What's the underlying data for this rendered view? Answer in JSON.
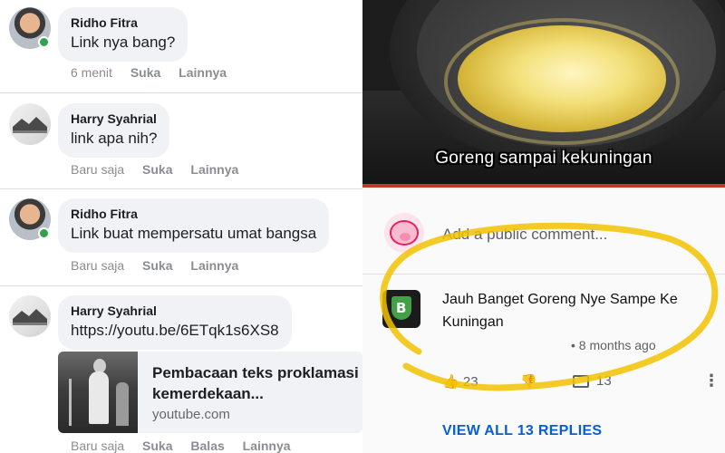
{
  "facebook": {
    "comments": [
      {
        "author": "Ridho Fitra",
        "text": "Link nya bang?",
        "time": "6 menit",
        "like": "Suka",
        "more": "Lainnya"
      },
      {
        "author": "Harry Syahrial",
        "text": "link apa nih?",
        "time": "Baru saja",
        "like": "Suka",
        "more": "Lainnya"
      },
      {
        "author": "Ridho Fitra",
        "text": "Link buat mempersatu umat bangsa",
        "time": "Baru saja",
        "like": "Suka",
        "more": "Lainnya"
      },
      {
        "author": "Harry Syahrial",
        "text": "https://youtu.be/6ETqk1s6XS8",
        "time": "Baru saja",
        "like": "Suka",
        "reply": "Balas",
        "more": "Lainnya"
      }
    ],
    "link_card": {
      "title": "Pembacaan teks proklamasi kemerdekaan...",
      "domain": "youtube.com"
    }
  },
  "meme": {
    "caption": "Goreng sampai kekuningan"
  },
  "youtube": {
    "add_comment_placeholder": "Add a public comment...",
    "comment_text": "Jauh Banget Goreng Nye Sampe Ke Kuningan",
    "comment_time": "• 8 months ago",
    "like_count": "23",
    "reply_count": "13",
    "view_replies": "VIEW ALL 13 REPLIES",
    "marker_color": "#f2c200"
  },
  "colors": {
    "fb_bubble": "#f0f2f5",
    "online_dot": "#31a24c",
    "yt_link": "#065fd4"
  }
}
